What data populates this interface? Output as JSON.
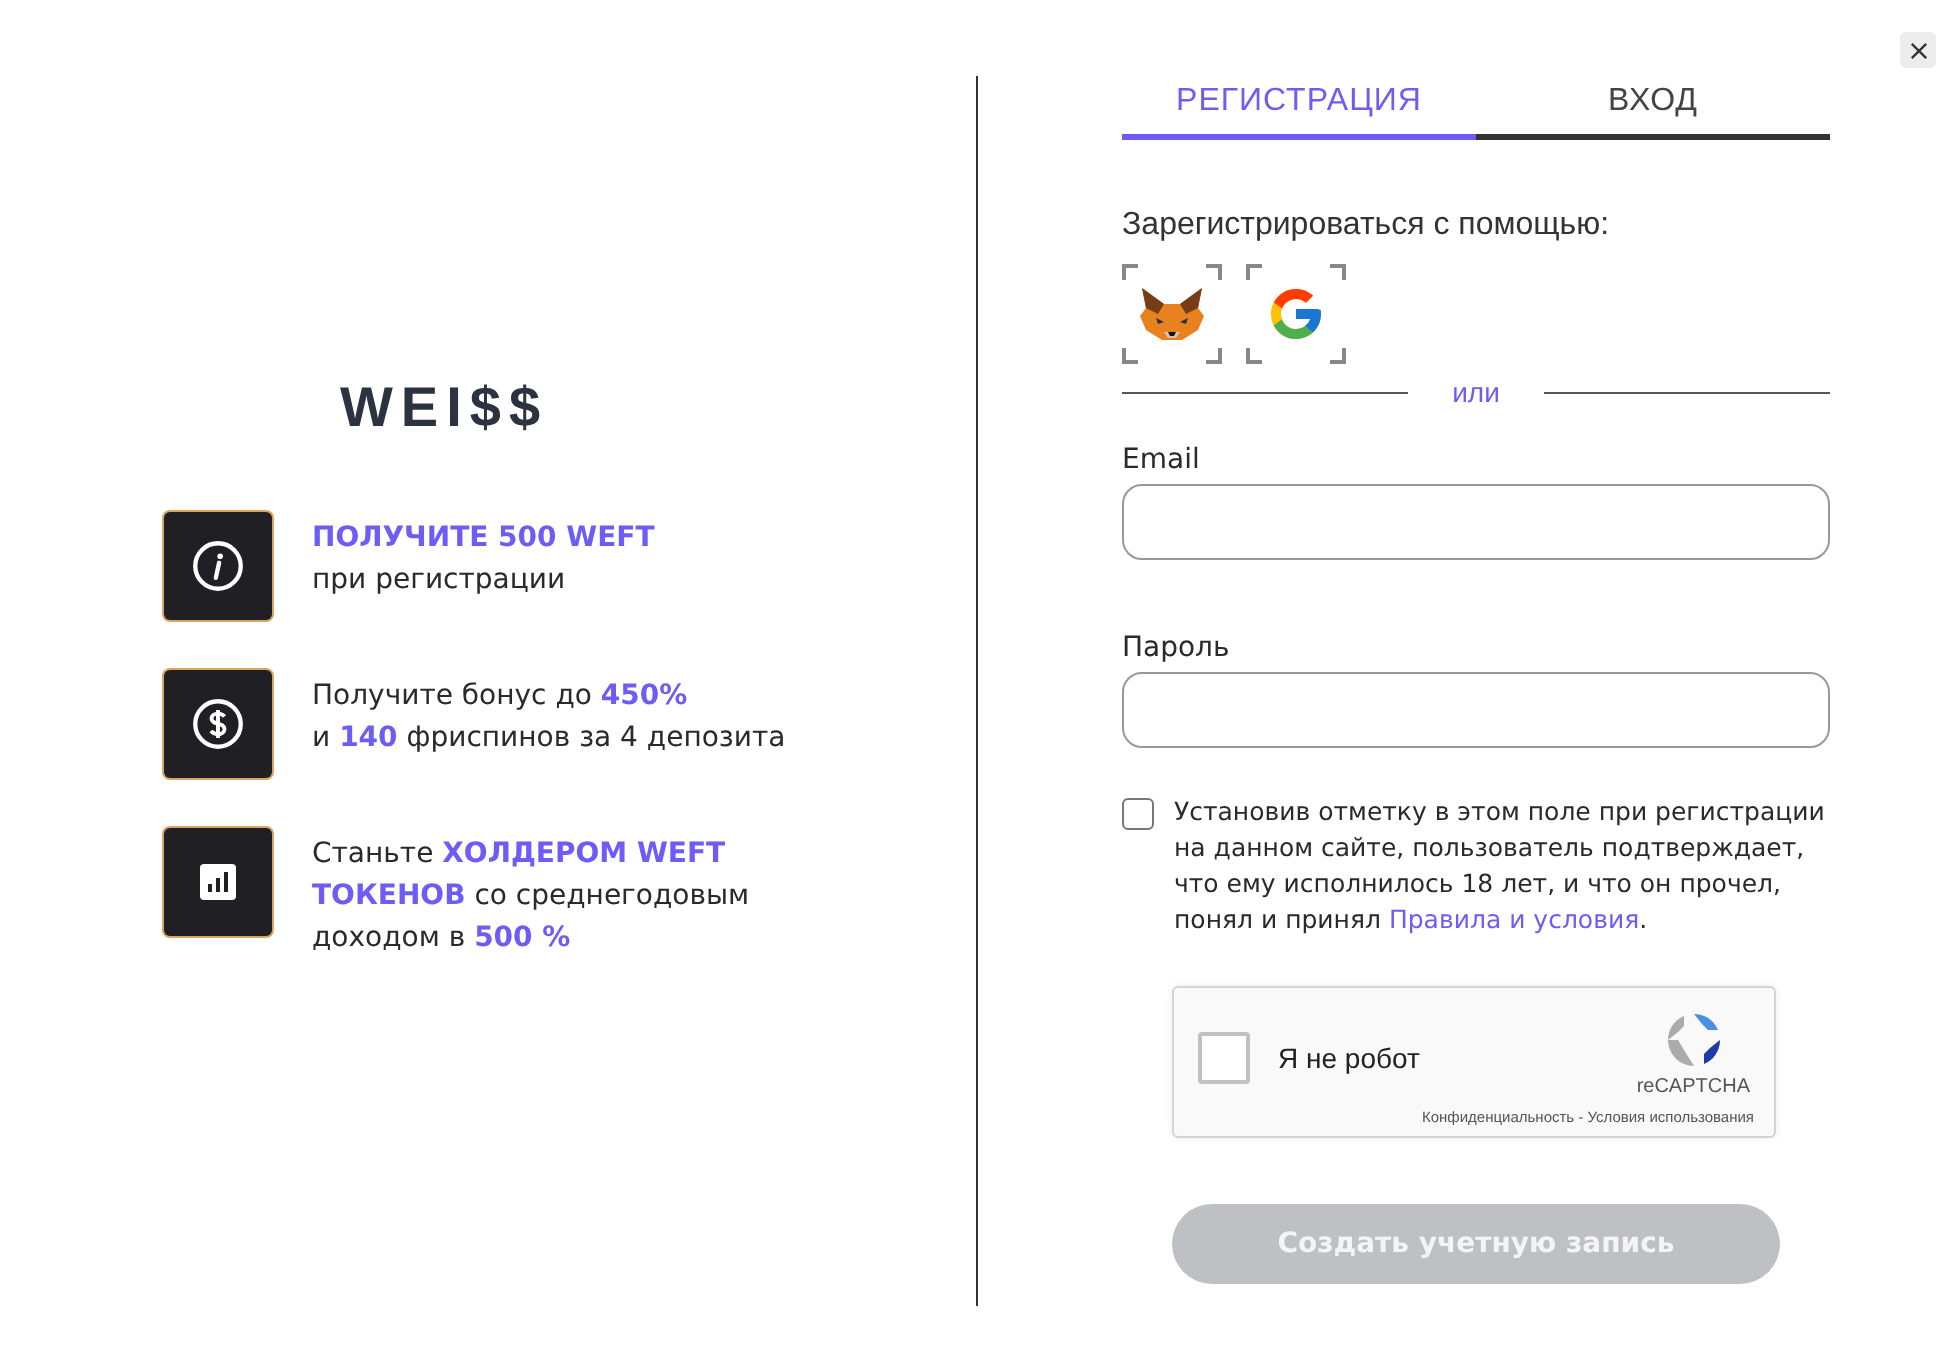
{
  "logo": "WEI$$",
  "features": [
    {
      "kind": "info",
      "text": "**ПОЛУЧИТЕ 500 WEFT**\nпри регистрации"
    },
    {
      "kind": "dollar",
      "text": "Получите бонус до **450%**\nи **140** фриспинов за 4 депозита"
    },
    {
      "kind": "chart",
      "text": "Станьте **ХОЛДЕРОМ WEFT ТОКЕНОВ** со среднегодовым доходом в **500 %**"
    }
  ],
  "tabs": [
    {
      "label": "РЕГИСТРАЦИЯ",
      "selected": true
    },
    {
      "label": "ВХОД",
      "selected": false
    }
  ],
  "social_label": "Зарегистрироваться с помощью:",
  "social": [
    {
      "kind": "fox"
    },
    {
      "kind": "google"
    }
  ],
  "divider_text": "или",
  "fields": [
    {
      "label": "Email"
    },
    {
      "label": "Пароль"
    }
  ],
  "terms": {
    "checked": false,
    "text": "Установив отметку в этом поле при регистрации на данном сайте, пользователь подтверждает, что ему исполнилось 18 лет, и что он прочел, понял и принял",
    "link": "Правила и условия",
    "tail": "."
  },
  "captcha": {
    "checked": false,
    "label": "Я не робот",
    "brand": "reCAPTCHA",
    "links": "Конфиденциальность - Условия использования"
  },
  "submit": {
    "label": "Создать учетную запись",
    "disabled": true
  }
}
